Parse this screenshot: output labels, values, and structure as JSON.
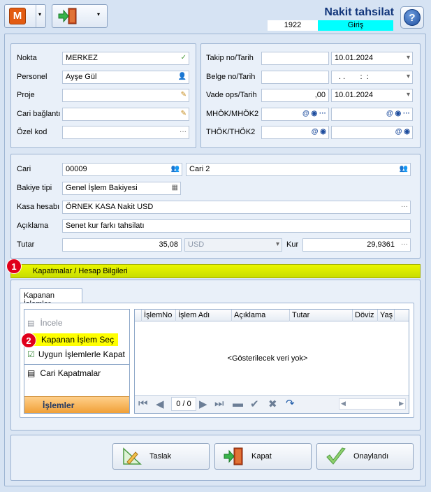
{
  "header": {
    "title": "Nakit tahsilat",
    "number": "1922",
    "direction": "Giriş",
    "logo_letter": "M"
  },
  "info": {
    "nokta_label": "Nokta",
    "nokta_value": "MERKEZ",
    "personel_label": "Personel",
    "personel_value": "Ayşe Gül",
    "proje_label": "Proje",
    "proje_value": "",
    "cari_baglanti_label": "Cari bağlantı",
    "cari_baglanti_value": "",
    "ozel_kod_label": "Özel kod",
    "ozel_kod_value": "",
    "takip_label": "Takip no/Tarih",
    "takip_no": "",
    "takip_date": "10.01.2024",
    "belge_label": "Belge no/Tarih",
    "belge_no": "",
    "belge_date": ". .       :  :",
    "vade_label": "Vade ops/Tarih",
    "vade_ops": ",00",
    "vade_date": "10.01.2024",
    "mhok_label": "MHÖK/MHÖK2",
    "mhok_1": "",
    "mhok_2": "",
    "thok_label": "THÖK/THÖK2",
    "thok_1": "",
    "thok_2": ""
  },
  "cari": {
    "cari_label": "Cari",
    "cari_code": "00009",
    "cari_name": "Cari 2",
    "bakiye_label": "Bakiye tipi",
    "bakiye_value": "Genel İşlem Bakiyesi",
    "kasa_label": "Kasa hesabı",
    "kasa_value": "ÖRNEK KASA Nakit USD",
    "aciklama_label": "Açıklama",
    "aciklama_value": "Senet kur farkı tahsilatı",
    "tutar_label": "Tutar",
    "tutar_value": "35,08",
    "currency": "USD",
    "kur_label": "Kur",
    "kur_value": "29,9361"
  },
  "kapatmalar": {
    "header": "Kapatmalar / Hesap Bilgileri",
    "marker_1": "1",
    "marker_2": "2",
    "tab": "Kapanan İşlemler",
    "menu": {
      "incele": "İncele",
      "kapanan_sec": "Kapanan İşlem Seç",
      "uygun": "Uygun İşlemlerle Kapat",
      "cari_kapatmalar": "Cari Kapatmalar",
      "footer": "İşlemler"
    },
    "grid": {
      "columns": [
        "İşlemNo",
        "İşlem Adı",
        "Açıklama",
        "Tutar",
        "Döviz",
        "Yaş"
      ],
      "empty": "<Gösterilecek veri yok>",
      "pager": "0 / 0"
    }
  },
  "buttons": {
    "taslak": "Taslak",
    "kapat": "Kapat",
    "onaylandi": "Onaylandı"
  },
  "colors": {
    "logo": "#e35b11",
    "title": "#11357a",
    "direction_bg": "#00ffff",
    "highlight_bar": "#d9ef00",
    "highlight_yellow": "#ffff00",
    "marker": "#e0001b"
  }
}
